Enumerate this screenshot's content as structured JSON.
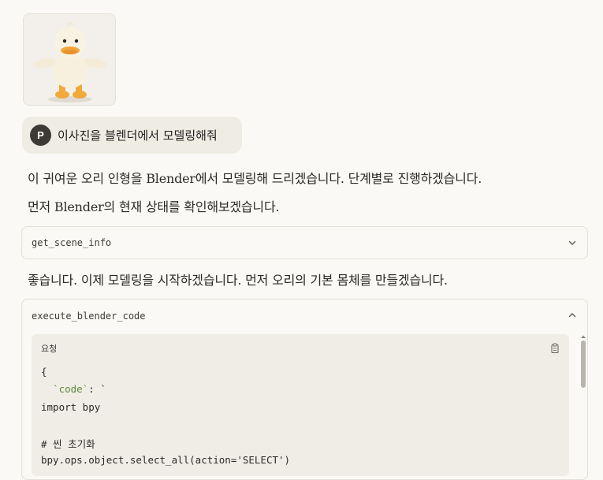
{
  "user_message": {
    "avatar_initial": "P",
    "text": "이사진을 블렌더에서 모델링해줘"
  },
  "assistant": {
    "para1": "이 귀여운 오리 인형을 Blender에서 모델링해 드리겠습니다. 단계별로 진행하겠습니다.",
    "para2": "먼저 Blender의 현재 상태를 확인해보겠습니다.",
    "para3": "좋습니다. 이제 모델링을 시작하겠습니다. 먼저 오리의 기본 몸체를 만들겠습니다."
  },
  "tool_calls": [
    {
      "name": "get_scene_info",
      "expanded": false,
      "icon": "chevron-down-icon"
    },
    {
      "name": "execute_blender_code",
      "expanded": true,
      "icon": "chevron-up-icon"
    }
  ],
  "code_panel": {
    "label": "요청",
    "lines": {
      "l1": "{",
      "l2_key": "`code`",
      "l2_rest": ": `",
      "l3": "import bpy",
      "l5": "# 씬 초기화",
      "l6": "bpy.ops.object.select_all(action='SELECT')"
    }
  },
  "colors": {
    "background": "#faf9f5",
    "bubble": "#efece4",
    "avatar": "#3d3a35",
    "code_key": "#5c8a3a"
  }
}
